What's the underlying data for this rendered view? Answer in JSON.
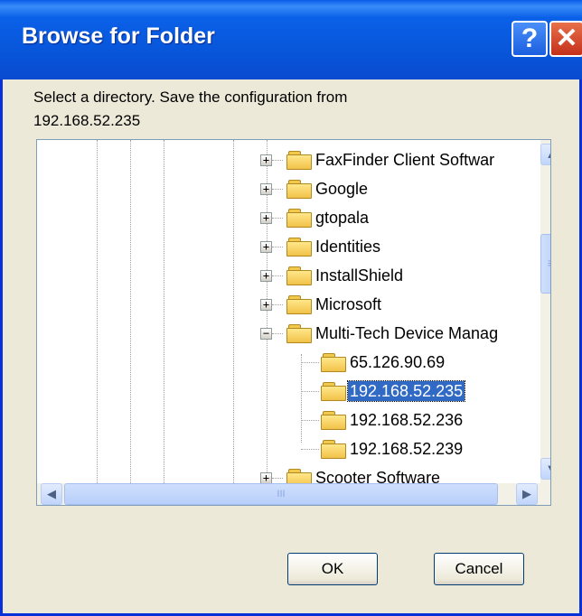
{
  "window": {
    "title": "Browse for Folder",
    "help_glyph": "?",
    "close_glyph": "✕"
  },
  "prompt": {
    "line1": "Select a directory.  Save the configuration from",
    "line2": "192.168.52.235"
  },
  "tree": {
    "items": [
      {
        "label": "FaxFinder Client Softwar",
        "expander": "+",
        "selected": false
      },
      {
        "label": "Google",
        "expander": "+",
        "selected": false
      },
      {
        "label": "gtopala",
        "expander": "+",
        "selected": false
      },
      {
        "label": "Identities",
        "expander": "+",
        "selected": false
      },
      {
        "label": "InstallShield",
        "expander": "+",
        "selected": false
      },
      {
        "label": "Microsoft",
        "expander": "+",
        "selected": false
      },
      {
        "label": "Multi-Tech Device Manag",
        "expander": "−",
        "selected": false
      },
      {
        "label": "65.126.90.69",
        "expander": "",
        "selected": false
      },
      {
        "label": "192.168.52.235",
        "expander": "",
        "selected": true
      },
      {
        "label": "192.168.52.236",
        "expander": "",
        "selected": false
      },
      {
        "label": "192.168.52.239",
        "expander": "",
        "selected": false
      },
      {
        "label": "Scooter Software",
        "expander": "+",
        "selected": false
      }
    ]
  },
  "scroll": {
    "up": "▲",
    "down": "▼",
    "left": "◀",
    "right": "▶",
    "grip_v": "≡",
    "grip_h": "III"
  },
  "buttons": {
    "ok": "OK",
    "cancel": "Cancel"
  },
  "colors": {
    "titlebar": "#0a5de8",
    "selection": "#316ac5",
    "dialog": "#ece9d8"
  }
}
